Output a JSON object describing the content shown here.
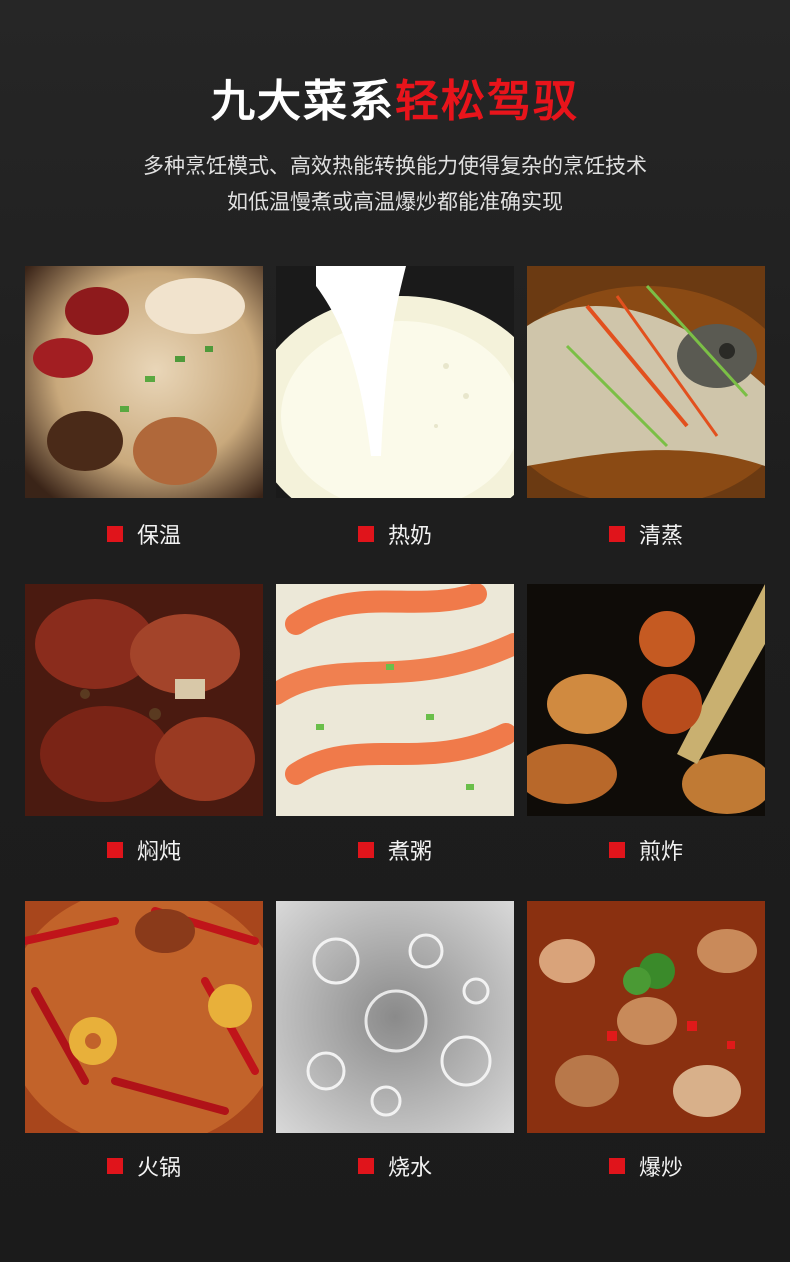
{
  "heading": {
    "white": "九大菜系",
    "red": "轻松驾驭"
  },
  "subtitle": {
    "line1": "多种烹饪模式、高效热能转换能力使得复杂的烹饪技术",
    "line2": "如低温慢煮或高温爆炒都能准确实现"
  },
  "accent_color": "#e0141b",
  "dishes": [
    {
      "label": "保温"
    },
    {
      "label": "热奶"
    },
    {
      "label": "清蒸"
    },
    {
      "label": "焖炖"
    },
    {
      "label": "煮粥"
    },
    {
      "label": "煎炸"
    },
    {
      "label": "火锅"
    },
    {
      "label": "烧水"
    },
    {
      "label": "爆炒"
    }
  ]
}
